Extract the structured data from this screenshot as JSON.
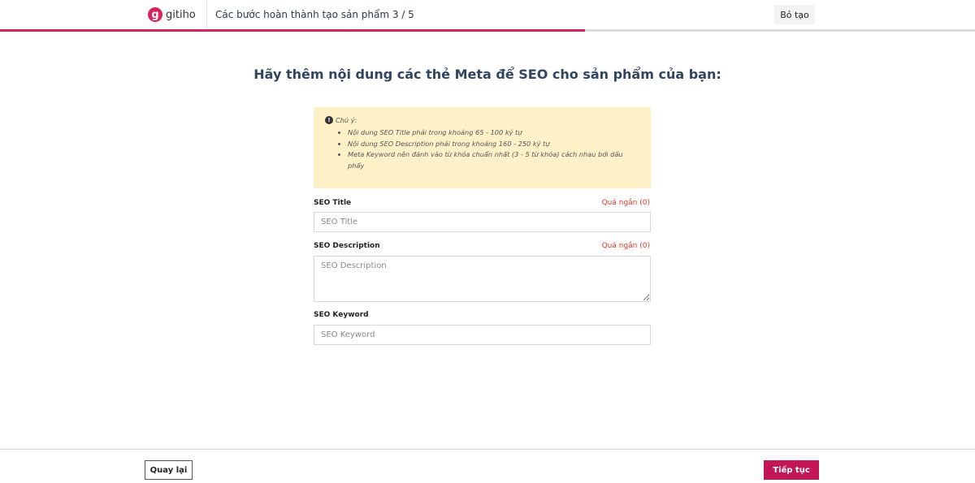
{
  "header": {
    "logo_mark": "g",
    "logo_text": "gitiho",
    "step_title": "Các bước hoàn thành tạo sản phẩm 3 / 5",
    "cancel_label": "Bỏ tạo"
  },
  "progress": {
    "current_step": 3,
    "total_steps": 5,
    "fraction": 0.6,
    "fill_color": "#d6245d"
  },
  "main": {
    "heading": "Hãy thêm nội dung các thẻ Meta để SEO cho sản phẩm của bạn:"
  },
  "note": {
    "icon": "exclamation-circle-icon",
    "title": "Chú ý:",
    "items": [
      "Nội dung SEO Title phải trong khoảng 65 - 100 ký tự",
      "Nội dung SEO Description phải trong khoảng 160 - 250 ký tự",
      "Meta Keyword nên đánh vào từ khóa chuẩn nhất (3 - 5 từ khóa) cách nhau bởi dấu phẩy"
    ]
  },
  "fields": {
    "seo_title": {
      "label": "SEO Title",
      "status": "Quá ngắn (0)",
      "value": "",
      "placeholder": "SEO Title"
    },
    "seo_description": {
      "label": "SEO Description",
      "status": "Quá ngắn (0)",
      "value": "",
      "placeholder": "SEO Description"
    },
    "seo_keyword": {
      "label": "SEO Keyword",
      "value": "",
      "placeholder": "SEO Keyword"
    }
  },
  "footer": {
    "back_label": "Quay lại",
    "next_label": "Tiếp tục"
  },
  "colors": {
    "accent": "#c31656",
    "warning_bg": "#fef1c8",
    "error_text": "#e0392b"
  }
}
